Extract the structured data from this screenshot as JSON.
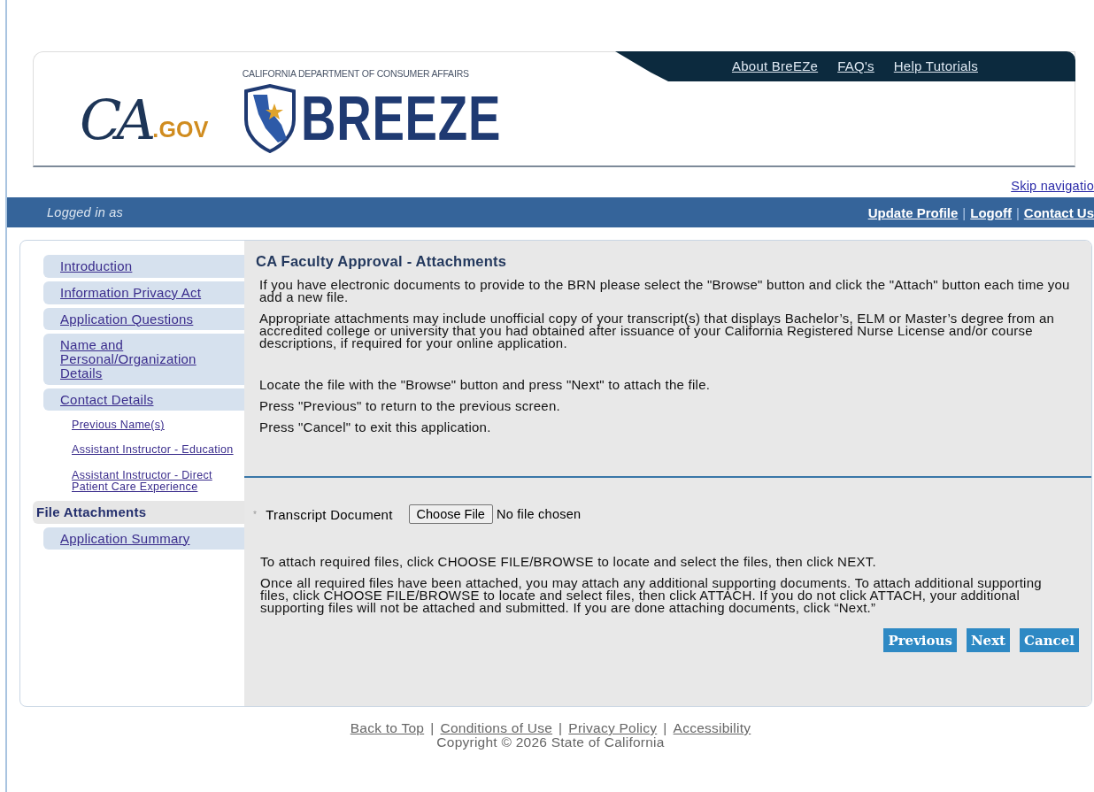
{
  "header": {
    "ca_logo": {
      "mark": "CA",
      "suffix": ".GOV"
    },
    "dept": "CALIFORNIA DEPARTMENT OF CONSUMER AFFAIRS",
    "brand": "BREEZE",
    "top_links": [
      "About BreEZe",
      "FAQ's",
      "Help Tutorials"
    ]
  },
  "skip_link": "Skip navigatio",
  "user_bar": {
    "logged_in": "Logged in as",
    "links": [
      {
        "kind": "link",
        "text": "Update Profile"
      },
      {
        "kind": "separator",
        "text": "|"
      },
      {
        "kind": "link",
        "text": "Logoff"
      },
      {
        "kind": "separator",
        "text": "|"
      },
      {
        "kind": "link",
        "text": "Contact Us"
      }
    ]
  },
  "nav": [
    {
      "label": "Introduction",
      "kind": "main",
      "selected": false
    },
    {
      "label": "Information Privacy Act",
      "kind": "main",
      "selected": false
    },
    {
      "label": "Application Questions",
      "kind": "main",
      "selected": false
    },
    {
      "label": "Name and Personal/Organization Details",
      "kind": "main",
      "selected": false
    },
    {
      "label": "Contact Details",
      "kind": "main",
      "selected": false
    },
    {
      "label": "Previous Name(s)",
      "kind": "sub",
      "selected": false
    },
    {
      "label": "Assistant Instructor - Education",
      "kind": "sub",
      "selected": false
    },
    {
      "label": "Assistant Instructor - Direct Patient Care Experience",
      "kind": "sub",
      "selected": false
    },
    {
      "label": "File Attachments",
      "kind": "main",
      "selected": true
    },
    {
      "label": "Application Summary",
      "kind": "main",
      "selected": false
    }
  ],
  "content": {
    "title": "CA Faculty Approval - Attachments",
    "intro": [
      "If you have electronic documents to provide to the BRN please select the \"Browse\" button and click the \"Attach\" button each time you add a new file.",
      "Appropriate attachments may include unofficial copy of your transcript(s) that displays Bachelor’s, ELM or Master’s degree from an accredited college or university that you had obtained after issuance of your California Registered Nurse License and/or course descriptions, if required for your online application."
    ],
    "steps": [
      "Locate the file with the \"Browse\" button and press \"Next\" to attach the file.",
      "Press \"Previous\" to return to the previous screen.",
      "Press \"Cancel\" to exit this application."
    ],
    "file_field": {
      "required_mark": "*",
      "label": "Transcript Document",
      "button": "Choose File",
      "status": "No file chosen"
    },
    "notes": [
      "To attach required files, click CHOOSE FILE/BROWSE to locate and select the files, then click NEXT.",
      "Once all required files have been attached, you may attach any additional supporting documents. To attach additional supporting files, click CHOOSE FILE/BROWSE to locate and select files, then click ATTACH. If you do not click ATTACH, your additional supporting files will not be attached and submitted. If you are done attaching documents, click “Next.”"
    ],
    "buttons": [
      "Previous",
      "Next",
      "Cancel"
    ]
  },
  "footer": {
    "links": [
      {
        "kind": "link",
        "text": "Back to Top"
      },
      {
        "kind": "separator",
        "text": "|"
      },
      {
        "kind": "link",
        "text": "Conditions of Use"
      },
      {
        "kind": "separator",
        "text": "|"
      },
      {
        "kind": "link",
        "text": "Privacy Policy"
      },
      {
        "kind": "separator",
        "text": "|"
      },
      {
        "kind": "link",
        "text": "Accessibility"
      }
    ],
    "copyright": "Copyright © 2026 State of California"
  }
}
